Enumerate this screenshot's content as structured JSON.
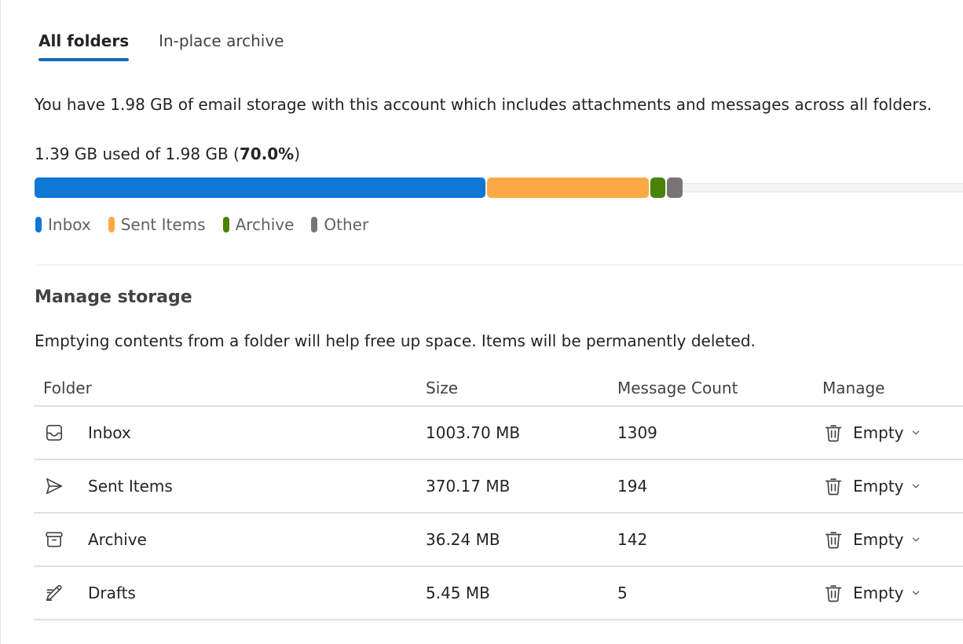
{
  "tabs": [
    {
      "label": "All folders",
      "active": true
    },
    {
      "label": "In-place archive",
      "active": false
    }
  ],
  "intro_text": "You have 1.98 GB of email storage with this account which includes attachments and messages across all folders.",
  "usage": {
    "used_text": "1.39 GB used of 1.98 GB (",
    "percent_text": "70.0%",
    "close_paren": ")"
  },
  "storage_bar": {
    "segments": [
      {
        "name": "Inbox",
        "fraction_of_total": 0.4869,
        "color": "#0f77d4"
      },
      {
        "name": "Sent Items",
        "fraction_of_total": 0.1757,
        "color": "#fba945"
      },
      {
        "name": "Archive",
        "fraction_of_total": 0.0179,
        "color": "#498205"
      },
      {
        "name": "Other",
        "fraction_of_total": 0.0186,
        "color": "#7a7574"
      }
    ]
  },
  "legend": [
    {
      "label": "Inbox",
      "color": "#0f77d4"
    },
    {
      "label": "Sent Items",
      "color": "#fba945"
    },
    {
      "label": "Archive",
      "color": "#498205"
    },
    {
      "label": "Other",
      "color": "#7a7574"
    }
  ],
  "manage": {
    "title": "Manage storage",
    "description": "Emptying contents from a folder will help free up space. Items will be permanently deleted."
  },
  "table": {
    "headers": {
      "folder": "Folder",
      "size": "Size",
      "count": "Message Count",
      "manage": "Manage"
    },
    "rows": [
      {
        "icon": "inbox-icon",
        "folder": "Inbox",
        "size": "1003.70 MB",
        "count": "1309",
        "action": "Empty"
      },
      {
        "icon": "send-icon",
        "folder": "Sent Items",
        "size": "370.17 MB",
        "count": "194",
        "action": "Empty"
      },
      {
        "icon": "archive-icon",
        "folder": "Archive",
        "size": "36.24 MB",
        "count": "142",
        "action": "Empty"
      },
      {
        "icon": "drafts-icon",
        "folder": "Drafts",
        "size": "5.45 MB",
        "count": "5",
        "action": "Empty"
      }
    ]
  }
}
